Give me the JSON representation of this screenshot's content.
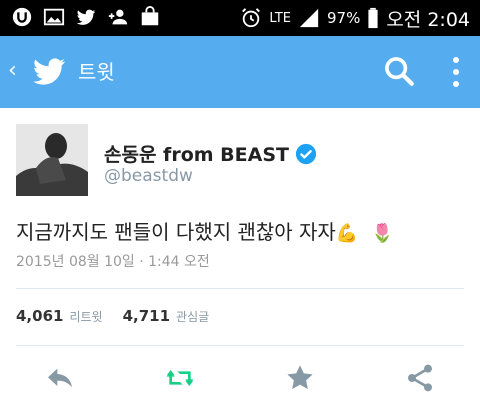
{
  "status_bar": {
    "network": "LTE",
    "battery": "97%",
    "time": "오전 2:04"
  },
  "app_bar": {
    "title": "트윗"
  },
  "tweet": {
    "display_name": "손동운 from BEAST",
    "handle": "@beastdw",
    "text": "지금까지도 팬들이 다했지 괜찮아 자자",
    "emojis": [
      "💪",
      "🌷"
    ],
    "timestamp": "2015년 08월 10일 · 1:44 오전"
  },
  "stats": {
    "retweets_count": "4,061",
    "retweets_label": "리트윗",
    "favorites_count": "4,711",
    "favorites_label": "관심글"
  },
  "colors": {
    "app_bar": "#55acee",
    "verified": "#1da1f2",
    "retweet_action": "#19cf86",
    "action_gray": "#8899a6"
  }
}
